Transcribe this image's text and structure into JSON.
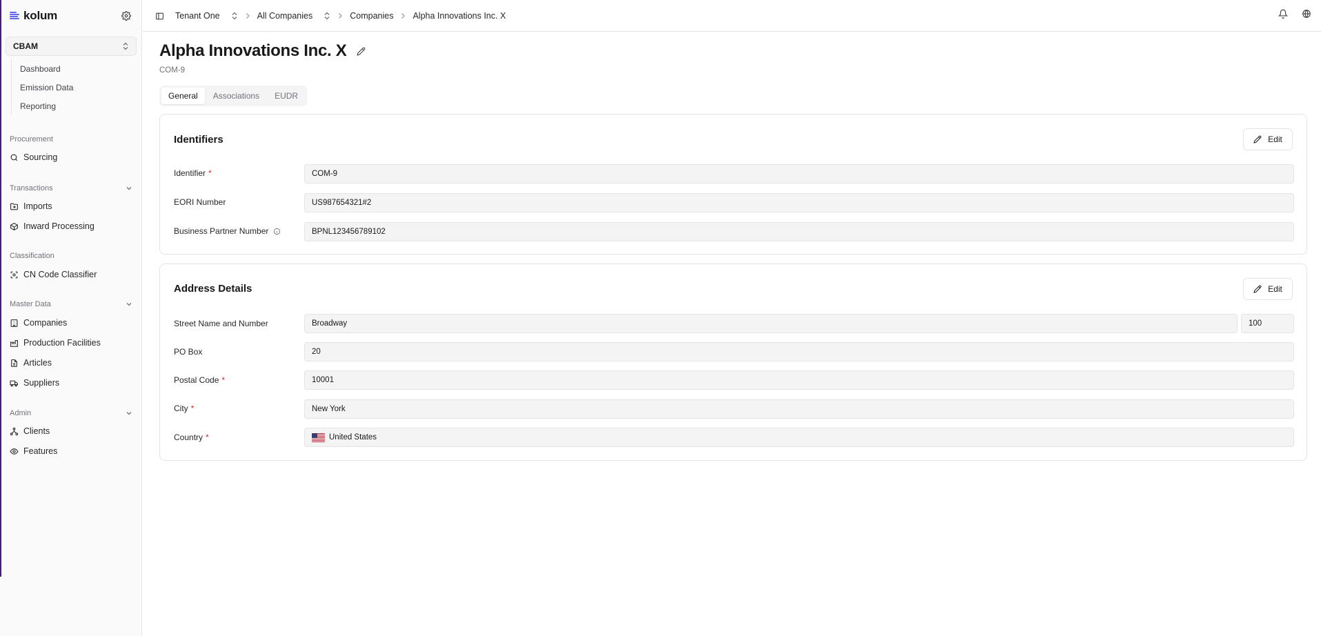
{
  "sidebar": {
    "logo_text": "kolum",
    "module": "CBAM",
    "sub_items": [
      "Dashboard",
      "Emission Data",
      "Reporting"
    ],
    "groups": {
      "procurement": {
        "label": "Procurement",
        "items": [
          "Sourcing"
        ]
      },
      "transactions": {
        "label": "Transactions",
        "items": [
          "Imports",
          "Inward Processing"
        ]
      },
      "classification": {
        "label": "Classification",
        "items": [
          "CN Code Classifier"
        ]
      },
      "master_data": {
        "label": "Master Data",
        "items": [
          "Companies",
          "Production Facilities",
          "Articles",
          "Suppliers"
        ]
      },
      "admin": {
        "label": "Admin",
        "items": [
          "Clients",
          "Features"
        ]
      }
    }
  },
  "breadcrumb": {
    "tenant": "Tenant One",
    "scope": "All Companies",
    "section": "Companies",
    "current": "Alpha Innovations Inc. X"
  },
  "page": {
    "title": "Alpha Innovations Inc. X",
    "subtitle": "COM-9",
    "tabs": [
      "General",
      "Associations",
      "EUDR"
    ],
    "active_tab": "General"
  },
  "identifiers": {
    "title": "Identifiers",
    "edit_label": "Edit",
    "fields": {
      "identifier": {
        "label": "Identifier",
        "value": "COM-9"
      },
      "eori": {
        "label": "EORI Number",
        "value": "US987654321#2"
      },
      "bpn": {
        "label": "Business Partner Number",
        "value": "BPNL123456789102"
      }
    }
  },
  "address": {
    "title": "Address Details",
    "edit_label": "Edit",
    "fields": {
      "street": {
        "label": "Street Name and Number",
        "value": "Broadway",
        "number": "100"
      },
      "po_box": {
        "label": "PO Box",
        "value": "20"
      },
      "postal": {
        "label": "Postal Code",
        "value": "10001"
      },
      "city": {
        "label": "City",
        "value": "New York"
      },
      "country": {
        "label": "Country",
        "value": "United States"
      }
    }
  },
  "colors": {
    "accent": "#6366f1",
    "required": "#dc2626",
    "strip": "#4c1d6f"
  }
}
